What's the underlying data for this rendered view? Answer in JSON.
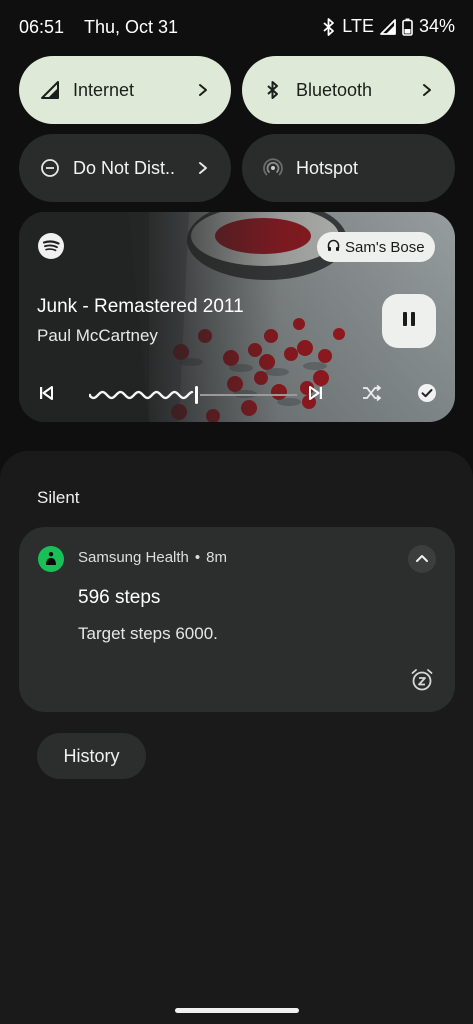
{
  "status": {
    "time": "06:51",
    "date": "Thu, Oct 31",
    "network": "LTE",
    "battery": "34%"
  },
  "tiles": [
    {
      "label": "Internet",
      "icon": "signal-icon",
      "active": true
    },
    {
      "label": "Bluetooth",
      "icon": "bluetooth-icon",
      "active": true
    },
    {
      "label": "Do Not Dist..",
      "icon": "do-not-disturb-icon",
      "active": false
    },
    {
      "label": "Hotspot",
      "icon": "hotspot-icon",
      "active": false
    }
  ],
  "media": {
    "app_icon": "spotify-icon",
    "device": "Sam's Bose",
    "song": "Junk - Remastered 2011",
    "artist": "Paul McCartney",
    "progress": 0.51
  },
  "notifications": {
    "section_label": "Silent",
    "items": [
      {
        "app": "Samsung Health",
        "age": "8m",
        "title": "596 steps",
        "body": "Target steps 6000."
      }
    ],
    "history_label": "History"
  },
  "colors": {
    "tile_active": "#dfe9d8",
    "tile_inactive": "#2a2b2b",
    "card": "#2c2d2d",
    "samsung_health": "#19c058"
  }
}
